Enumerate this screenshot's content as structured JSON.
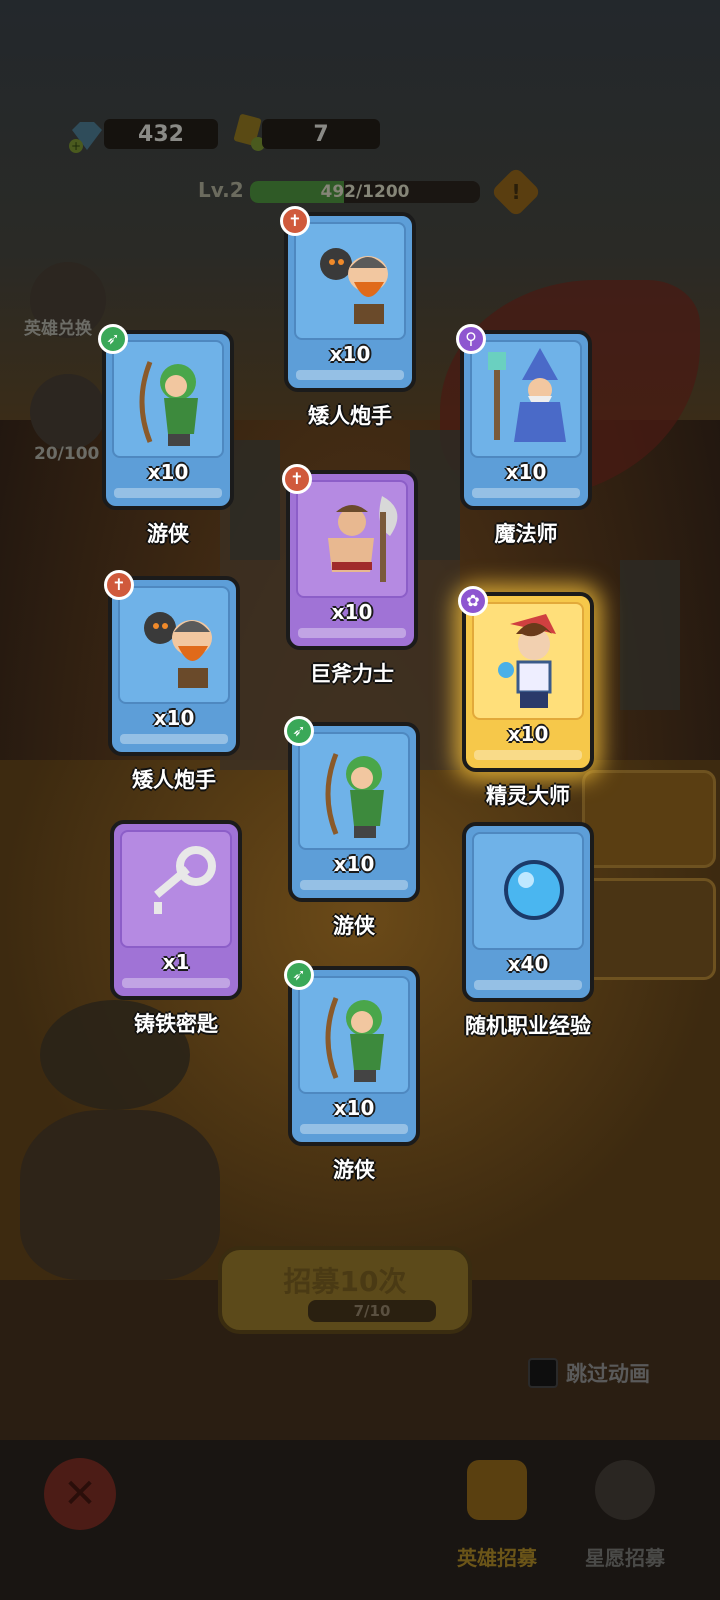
{
  "resources": {
    "gems": "432",
    "tickets": "7"
  },
  "level": {
    "label": "Lv.2",
    "xp_text": "492/1200",
    "progress": 0.41
  },
  "side_buttons": {
    "hero_exchange": "英雄兑换",
    "stars_count": "20/100"
  },
  "rewards": [
    {
      "name": "矮人炮手",
      "qty": "x10",
      "rarity": "blue",
      "class_icon": "cannon-class-icon",
      "hero": "dwarf-gunner"
    },
    {
      "name": "游侠",
      "qty": "x10",
      "rarity": "blue",
      "class_icon": "bow-class-icon",
      "hero": "ranger"
    },
    {
      "name": "魔法师",
      "qty": "x10",
      "rarity": "blue",
      "class_icon": "staff-class-icon",
      "hero": "mage"
    },
    {
      "name": "巨斧力士",
      "qty": "x10",
      "rarity": "purple",
      "class_icon": "cannon-class-icon",
      "hero": "axe-warrior"
    },
    {
      "name": "矮人炮手",
      "qty": "x10",
      "rarity": "blue",
      "class_icon": "cannon-class-icon",
      "hero": "dwarf-gunner"
    },
    {
      "name": "精灵大师",
      "qty": "x10",
      "rarity": "gold",
      "class_icon": "paw-class-icon",
      "hero": "spirit-master"
    },
    {
      "name": "游侠",
      "qty": "x10",
      "rarity": "blue",
      "class_icon": "bow-class-icon",
      "hero": "ranger"
    },
    {
      "name": "铸铁密匙",
      "qty": "x1",
      "rarity": "purple",
      "class_icon": "",
      "hero": "iron-key"
    },
    {
      "name": "随机职业经验",
      "qty": "x40",
      "rarity": "blue",
      "class_icon": "",
      "hero": "question-orb"
    },
    {
      "name": "游侠",
      "qty": "x10",
      "rarity": "blue",
      "class_icon": "bow-class-icon",
      "hero": "ranger"
    }
  ],
  "recruit": {
    "label": "招募10次",
    "progress_text": "7/10"
  },
  "skip_animation": "跳过动画",
  "nav": {
    "hero_recruit": "英雄招募",
    "wish_recruit": "星愿招募"
  },
  "colors": {
    "blue_card": "#5d9ed8",
    "purple_card": "#a073d6",
    "gold_card": "#f6c84a",
    "xp_fill": "#2f5a26"
  }
}
